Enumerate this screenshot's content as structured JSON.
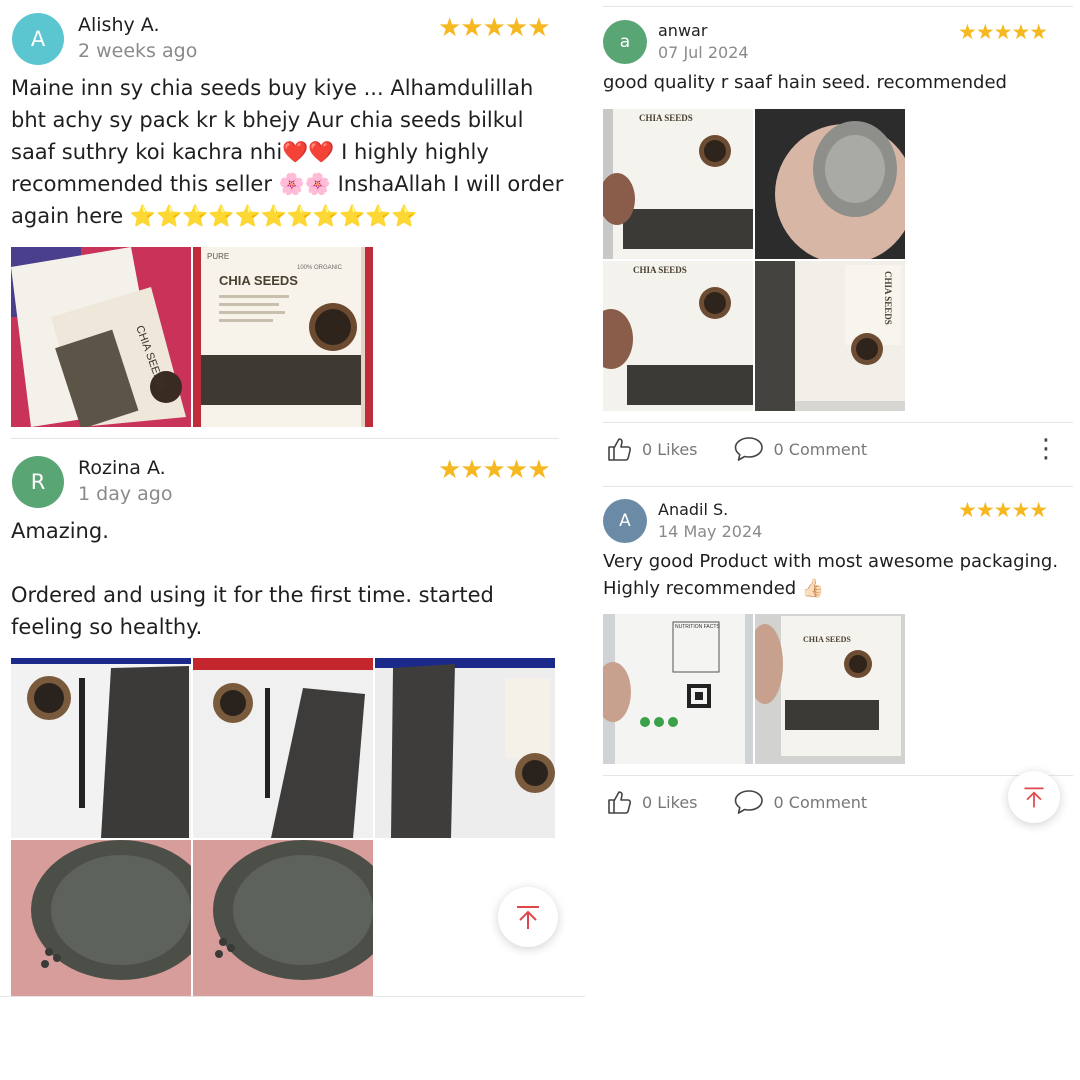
{
  "left_column": {
    "reviews": [
      {
        "avatar_letter": "A",
        "avatar_color": "#5bc6cf",
        "name": "Alishy A.",
        "date": "2 weeks ago",
        "stars": "★★★★★",
        "text": "Maine inn sy chia seeds buy kiye ... Alhamdulillah bht achy sy pack kr k bhejy Aur chia seeds bilkul saaf suthry koi kachra nhi❤️❤️ I highly highly recommended this seller 🌸🌸 InshaAllah I will order again here ⭐⭐⭐⭐⭐⭐⭐⭐⭐⭐⭐",
        "photo_caption_1": "CHIA SEEDS",
        "photo_caption_2": "CHIA SEEDS",
        "photo_brand": "PURE",
        "photo_tag": "100% ORGANIC"
      },
      {
        "avatar_letter": "R",
        "avatar_color": "#5aa574",
        "name": "Rozina A.",
        "date": "1 day ago",
        "stars": "★★★★★",
        "text": "Amazing.\n\nOrdered and using it for the first time. started feeling so healthy."
      }
    ]
  },
  "right_column": {
    "reviews": [
      {
        "avatar_letter": "a",
        "avatar_color": "#5aa574",
        "name": "anwar",
        "date": "07 Jul 2024",
        "stars": "★★★★★",
        "text": "good quality r saaf hain seed. recommended",
        "photo_caption_1": "CHIA SEEDS",
        "photo_caption_2": "CHIA SEEDS",
        "photo_caption_3": "CHIA SEEDS",
        "likes_label": "0 Likes",
        "comments_label": "0 Comment",
        "more_label": "⋮"
      },
      {
        "avatar_letter": "A",
        "avatar_color": "#6b8aa5",
        "name": "Anadil S.",
        "date": "14 May 2024",
        "stars": "★★★★★",
        "text": "Very good Product with most awesome packaging. Highly recommended 👍🏻",
        "photo_caption_1": "NUTRITION FACTS",
        "photo_caption_2": "CHIA SEEDS",
        "likes_label": "0 Likes",
        "comments_label": "0 Comment"
      }
    ]
  },
  "colors": {
    "star": "#f5b820",
    "back_to_top": "#e0474c",
    "divider": "#e6e6e6"
  },
  "icons": {
    "like": "thumbs-up-icon",
    "comment": "speech-bubble-icon",
    "more": "vertical-dots-icon",
    "back_to_top": "arrow-up-to-line-icon"
  }
}
